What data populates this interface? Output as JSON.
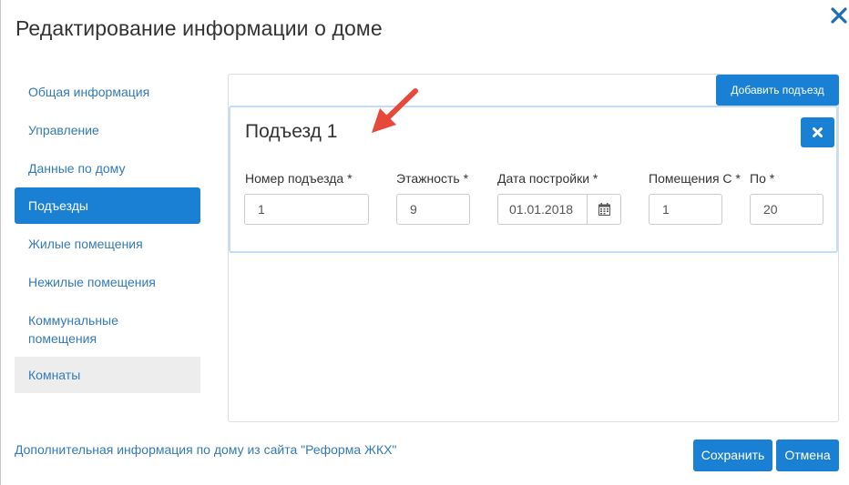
{
  "dialog": {
    "title": "Редактирование информации о доме"
  },
  "sidebar": {
    "items": [
      {
        "label": "Общая информация"
      },
      {
        "label": "Управление"
      },
      {
        "label": "Данные по дому"
      },
      {
        "label": "Подъезды",
        "active": true
      },
      {
        "label": "Жилые помещения"
      },
      {
        "label": "Нежилые помещения"
      },
      {
        "label": "Коммунальные помещения"
      },
      {
        "label": "Комнаты"
      }
    ]
  },
  "toolbar": {
    "add_entrance_label": "Добавить подъезд"
  },
  "entrance": {
    "title": "Подъезд 1",
    "fields": {
      "number": {
        "label": "Номер подъезда *",
        "value": "1"
      },
      "floors": {
        "label": "Этажность *",
        "value": "9"
      },
      "build_date": {
        "label": "Дата постройки *",
        "value": "01.01.2018"
      },
      "rooms_from": {
        "label": "Помещения С *",
        "value": "1"
      },
      "rooms_to": {
        "label": "По *",
        "value": "20"
      }
    }
  },
  "footer": {
    "link": "Дополнительная информация по дому из сайта \"Реформа ЖКХ\"",
    "save_label": "Сохранить",
    "cancel_label": "Отмена"
  },
  "colors": {
    "primary": "#1a80d4",
    "link": "#337ab7",
    "arrow": "#e8483a"
  },
  "icons": [
    "close-icon",
    "calendar-icon",
    "delete-icon",
    "arrow-annotation"
  ]
}
